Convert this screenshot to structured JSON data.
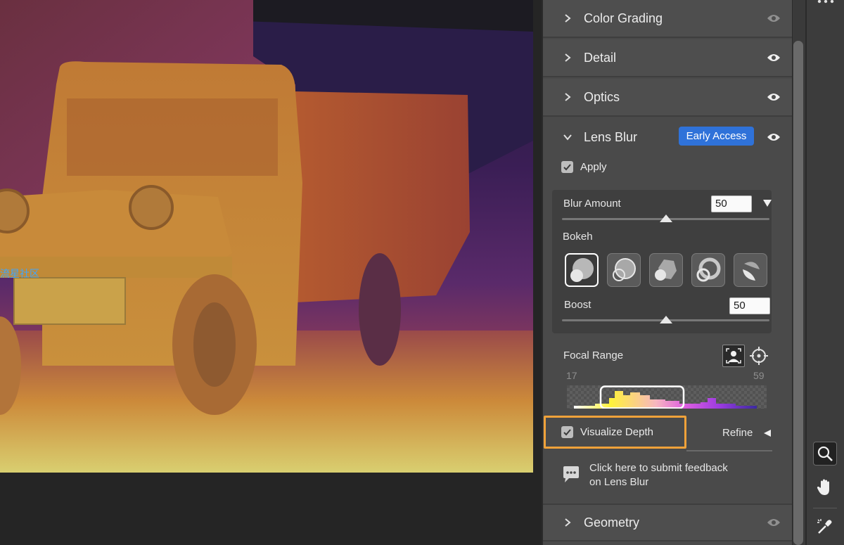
{
  "watermark": "流星社区",
  "panel": {
    "sections": {
      "color_grading": "Color Grading",
      "detail": "Detail",
      "optics": "Optics",
      "lens_blur": "Lens Blur",
      "geometry": "Geometry"
    },
    "lens_blur": {
      "badge": "Early Access",
      "apply_label": "Apply",
      "apply_checked": true,
      "blur_amount_label": "Blur Amount",
      "blur_amount_value": "50",
      "blur_amount_level": 0.5,
      "bokeh_label": "Bokeh",
      "bokeh_shapes": [
        "circle",
        "bubble",
        "blade",
        "ring",
        "cat-eye"
      ],
      "bokeh_selected": 0,
      "boost_label": "Boost",
      "boost_value": "50",
      "boost_level": 0.5,
      "focal_range_label": "Focal Range",
      "focal_min": "17",
      "focal_max": "59",
      "visualize_depth_label": "Visualize Depth",
      "visualize_depth_checked": true,
      "refine_label": "Refine",
      "feedback_line1": "Click here to submit feedback",
      "feedback_line2": "on Lens Blur"
    }
  },
  "colors": {
    "accent": "#2f72d9",
    "highlight": "#f0a23a"
  }
}
